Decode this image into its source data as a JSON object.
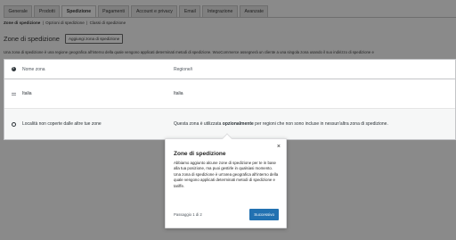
{
  "tabs": [
    "Generale",
    "Prodotti",
    "Spedizione",
    "Pagamenti",
    "Account e privacy",
    "Email",
    "Integrazione",
    "Avanzate"
  ],
  "active_tab": "Spedizione",
  "subnav": {
    "current": "Zone di spedizione",
    "items": [
      "Opzioni di spedizione",
      "Classi di spedizione"
    ],
    "separator": "|"
  },
  "heading": {
    "title": "Zone di spedizione",
    "add_button": "Aggiungi zona di spedizione"
  },
  "description": "Una zona di spedizione è una regione geografica all'interno della quale vengono applicati determinati metodi di spedizione. WooCommerce assegnerà un cliente a una singola zona usando il suo indirizzo di spedizione e",
  "table": {
    "headers": {
      "name": "Nome zona",
      "regions": "Regione/i"
    },
    "zones": [
      {
        "name": "Italia",
        "regions": "Italia"
      }
    ],
    "rest_row": {
      "name": "Località non coperte dalle altre tue zone",
      "region_before": "Questa zona è utilizzata ",
      "region_bold": "opzionalmente",
      "region_after": " per regioni che non sono incluse in nessun'altra zona di spedizione."
    }
  },
  "popover": {
    "title": "Zone di spedizione",
    "paragraph1": "Abbiamo aggiunto alcune zone di spedizione per te in base alla tua posizione, ma puoi gestirle in qualsiasi momento.",
    "paragraph2": "Una zona di spedizione è un'area geografica all'interno della quale vengono applicati determinati metodi di spedizione e tariffe.",
    "close": "×",
    "step": "Passaggio 1 di 2",
    "next_button": "Successivo"
  },
  "colors": {
    "accent": "#2271b1",
    "overlay": "#8a8a8a"
  }
}
